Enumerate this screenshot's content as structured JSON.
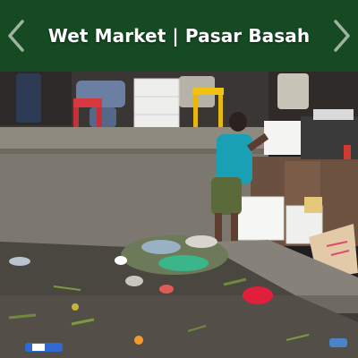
{
  "header": {
    "title": "Wet Market | Pasar Basah",
    "prev_icon": "chevron-left-icon",
    "next_icon": "chevron-right-icon",
    "background_color": "#154a22",
    "text_color": "#ffffff"
  },
  "photo": {
    "subject": "wet-market-photo"
  }
}
